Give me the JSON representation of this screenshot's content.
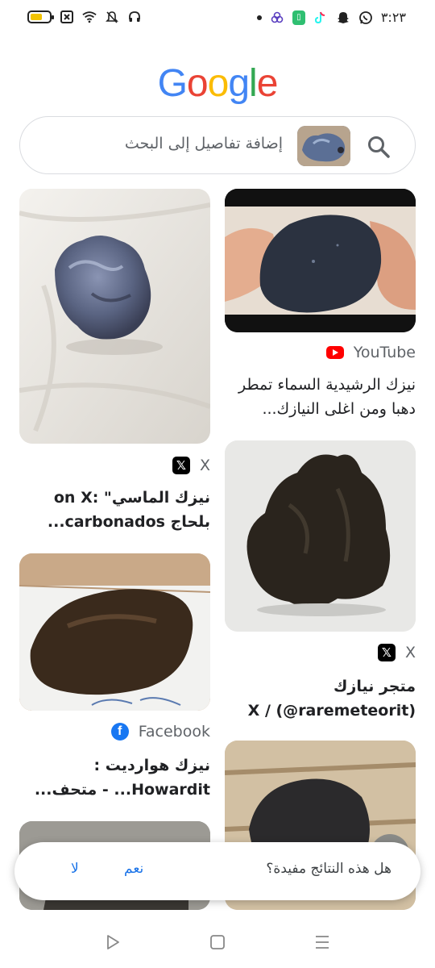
{
  "status_bar": {
    "time": "٣:٢٣",
    "left_icons": [
      "battery-icon",
      "close-box-icon",
      "wifi-icon",
      "bell-muted-icon",
      "headphones-icon"
    ],
    "right_icons": [
      "notification-dot",
      "app-icon",
      "green-app-icon",
      "tiktok-icon",
      "snapchat-icon",
      "whatsapp-icon"
    ]
  },
  "logo": {
    "letters": [
      "G",
      "o",
      "o",
      "g",
      "l",
      "e"
    ],
    "colors": [
      "#4285F4",
      "#EA4335",
      "#FBBC05",
      "#4285F4",
      "#34A853",
      "#EA4335"
    ]
  },
  "search": {
    "placeholder": "إضافة تفاصيل إلى البحث",
    "icon": "search-icon"
  },
  "results": [
    {
      "source": "YouTube",
      "source_icon": "youtube-icon",
      "title": "نيزك الرشيدية السماء تمطر دهبا ومن اغلى النيازك...",
      "bold": false
    },
    {
      "source": "X",
      "source_icon": "x-icon",
      "title": "نيزك الماسي\" :on X بلحاج carbonados...",
      "bold": false
    },
    {
      "source": "X",
      "source_icon": "x-icon",
      "title": "متجر نيازك (raremeteorit@) / X",
      "bold": false
    },
    {
      "source": "Facebook",
      "source_icon": "facebook-icon",
      "title": "نيزك هوارديت : Howardit... - متحف...",
      "bold": false
    }
  ],
  "feedback": {
    "question": "هل هذه النتائج مفيدة؟",
    "yes": "نعم",
    "no": "لا"
  },
  "nav": [
    "back-icon",
    "home-icon",
    "recents-icon"
  ]
}
